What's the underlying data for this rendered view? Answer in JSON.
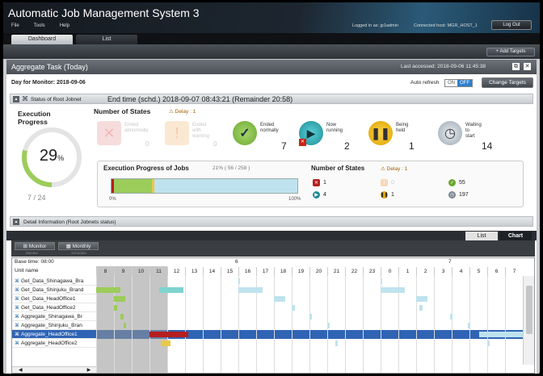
{
  "app": {
    "title": "Automatic Job Management System 3",
    "menu": [
      "File",
      "Tools",
      "Help"
    ],
    "logged_in": "Logged in as: jp1admin",
    "connected_host": "Connected host: MGR_HOST_1",
    "logout_label": "Log Out"
  },
  "tabs": [
    "Dashboard",
    "List"
  ],
  "subbar": {
    "add_targets": "+ Add Targets"
  },
  "panel": {
    "title": "Aggregate Task (Today)",
    "last_accessed": "Last accessed: 2018-09-06 11:45:38"
  },
  "toolbar": {
    "day_for_monitor": "Day for Monitor: 2018-09-06",
    "auto_refresh": "Auto refresh",
    "toggle_on": "ON",
    "toggle_off": "OFF",
    "change_targets": "Change Targets"
  },
  "status_section": {
    "label": "Status of Root Jobnet",
    "end_time": "End time (schd.) 2018-09-07 08:43:21 (Remainder 20:58)"
  },
  "execution": {
    "title_line1": "Execution",
    "title_line2": "Progress",
    "percent": 29,
    "percent_sign": "%",
    "count_text": "7 / 24"
  },
  "states": {
    "title": "Number of States",
    "delay": "Delay : 1",
    "items": [
      {
        "line1": "Ended",
        "line2": "abnormally",
        "count": "0"
      },
      {
        "line1": "Ended with",
        "line2": "warning",
        "count": "0"
      },
      {
        "line1": "Ended",
        "line2": "normally",
        "count": "7"
      },
      {
        "line1": "Now running",
        "line2": "",
        "count": "2"
      },
      {
        "line1": "Being held",
        "line2": "",
        "count": "1"
      },
      {
        "line1": "Waiting to",
        "line2": "start",
        "count": "14"
      }
    ]
  },
  "jobs_progress": {
    "title": "Execution Progress of Jobs",
    "percent_text": "21% ( 56 / 258 )",
    "done": 56,
    "total": 258,
    "label_0": "0%",
    "label_100": "100%",
    "states_title": "Number of States",
    "delay": "Delay : 1",
    "counts": {
      "abnormal": "1",
      "warning": "0",
      "normal": "55",
      "running": "4",
      "held": "1",
      "waiting": "197"
    }
  },
  "detail_section": {
    "label": "Detail Information (Root Jobnets status)"
  },
  "view_tabs": [
    "List",
    "Chart"
  ],
  "gantt": {
    "monitor_btn": "Monitor",
    "monthly_btn": "Monthly",
    "monitor_sub": "Monitor",
    "schedule_sub": "Schedule",
    "base_time": "Base time: 08:00",
    "unit_name_header": "Unit name",
    "day_labels": [
      "6",
      "7"
    ],
    "hours": [
      "8",
      "9",
      "10",
      "11",
      "12",
      "13",
      "14",
      "15",
      "16",
      "17",
      "18",
      "19",
      "20",
      "21",
      "22",
      "23",
      "0",
      "1",
      "2",
      "3",
      "4",
      "5",
      "6",
      "7"
    ],
    "rows": [
      "Get_Data_Shinagawa_Bra",
      "Get_Data_Shinjuku_Brand",
      "Get_Data_HeadOffice1",
      "Get_Data_HeadOffice2",
      "Aggregate_Shinagawa_Br",
      "Aggregate_Shinjuku_Bran",
      "Aggregate_HeadOffice1",
      "Aggregate_HeadOffice2"
    ],
    "selected_row": 6,
    "colors": {
      "green": "#9ccc5a",
      "cyan": "#bfe3ee",
      "red": "#b51f1f",
      "yellow": "#e8c84a",
      "teal": "#7fd3d0"
    }
  }
}
